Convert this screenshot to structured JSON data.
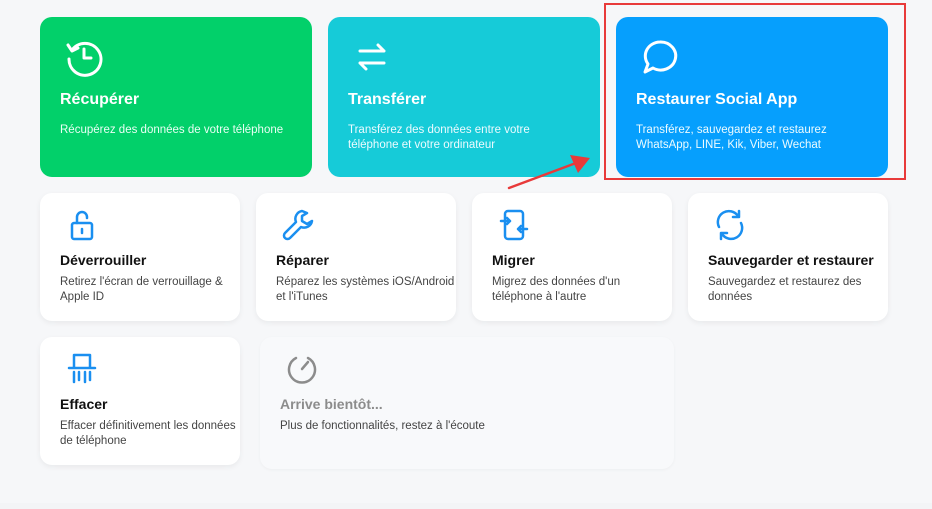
{
  "feature_cards": [
    {
      "title": "Récupérer",
      "desc": "Récupérez des données de votre téléphone",
      "icon": "recover-clock-icon"
    },
    {
      "title": "Transférer",
      "desc": "Transférez des données entre votre téléphone et votre ordinateur",
      "icon": "transfer-arrows-icon"
    },
    {
      "title": "Restaurer Social App",
      "desc": "Transférez, sauvegardez et restaurez WhatsApp, LINE, Kik, Viber, Wechat",
      "icon": "chat-bubble-icon"
    }
  ],
  "tool_cards": [
    {
      "title": "Déverrouiller",
      "desc": "Retirez l'écran de verrouillage & Apple ID",
      "icon": "unlock-icon"
    },
    {
      "title": "Réparer",
      "desc": "Réparez les systèmes iOS/Android et l'iTunes",
      "icon": "wrench-icon"
    },
    {
      "title": "Migrer",
      "desc": "Migrez des données d'un téléphone à l'autre",
      "icon": "phone-migrate-icon"
    },
    {
      "title": "Sauvegarder et restaurer",
      "desc": "Sauvegardez et restaurez des données",
      "icon": "sync-icon"
    },
    {
      "title": "Effacer",
      "desc": "Effacer définitivement les données de téléphone",
      "icon": "shredder-icon"
    }
  ],
  "coming_soon": {
    "title": "Arrive bientôt...",
    "desc": "Plus de fonctionnalités, restez à l'écoute",
    "icon": "timer-icon"
  },
  "colors": {
    "green": "#02d06a",
    "teal": "#16cbd8",
    "blue": "#069ffd",
    "icon_blue": "#1a8ff0",
    "annotation_red": "#e83a3a"
  }
}
